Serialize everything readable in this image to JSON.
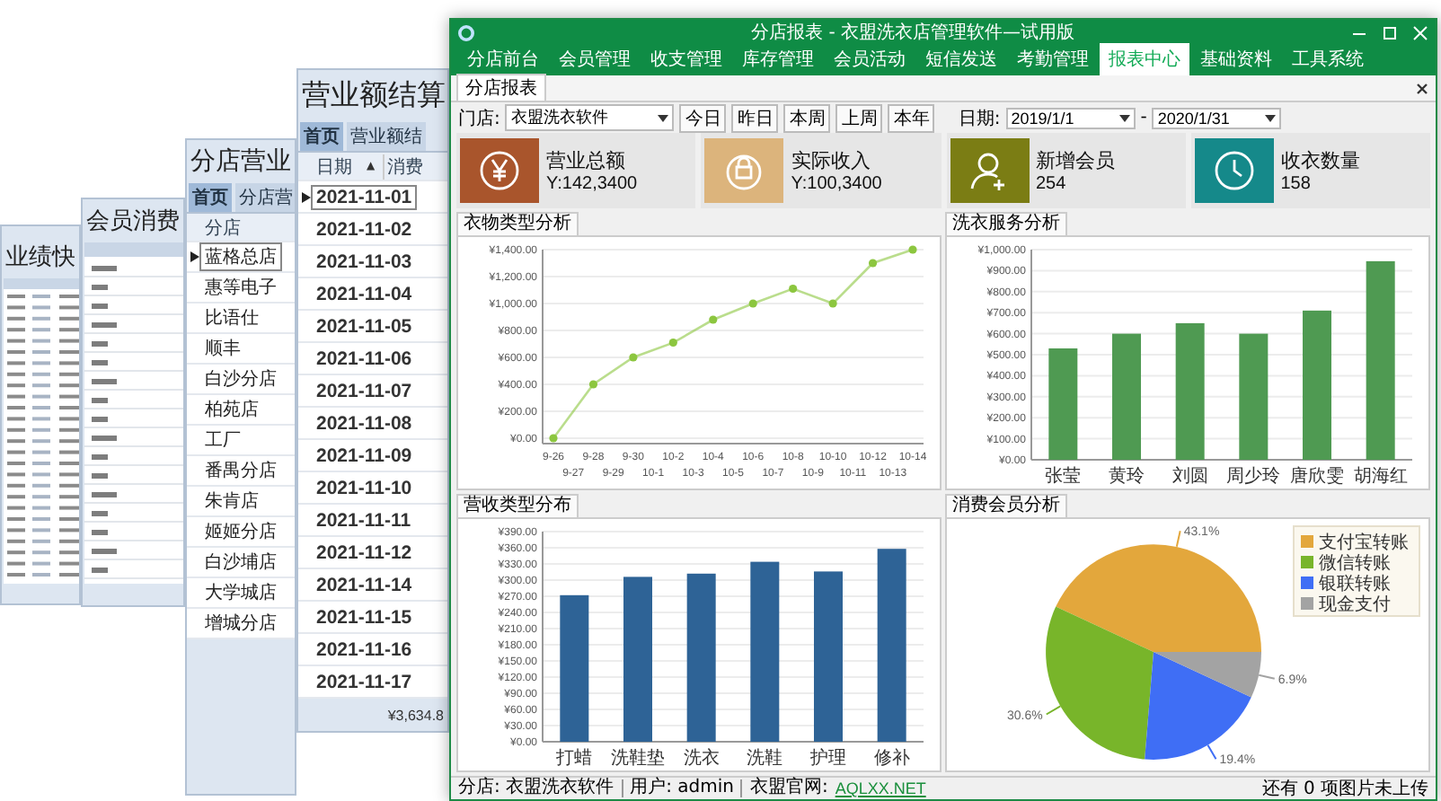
{
  "background_windows": [
    {
      "kind": "mini_table",
      "title": "业绩快"
    },
    {
      "kind": "list",
      "title": "会员消费"
    },
    {
      "kind": "stores",
      "title": "分店营业",
      "tabs": [
        {
          "label": "首页",
          "selected": true
        },
        {
          "label": "分店营",
          "selected": false
        }
      ],
      "column": "分店",
      "rows": [
        {
          "text": "蓝格总店",
          "selected": true
        },
        {
          "text": "惠等电子",
          "selected": false
        },
        {
          "text": "比语仕",
          "selected": false
        },
        {
          "text": "顺丰",
          "selected": false
        },
        {
          "text": "白沙分店",
          "selected": false
        },
        {
          "text": "柏苑店",
          "selected": false
        },
        {
          "text": "工厂",
          "selected": false
        },
        {
          "text": "番禺分店",
          "selected": false
        },
        {
          "text": "朱肯店",
          "selected": false
        },
        {
          "text": "姬姬分店",
          "selected": false
        },
        {
          "text": "白沙埔店",
          "selected": false
        },
        {
          "text": "大学城店",
          "selected": false
        },
        {
          "text": "增城分店",
          "selected": false
        }
      ]
    },
    {
      "kind": "dates",
      "title": "营业额结算",
      "tabs": [
        {
          "label": "首页",
          "selected": true
        },
        {
          "label": "营业额结",
          "selected": false
        }
      ],
      "column": "日期",
      "sort_mark": "▲",
      "column_2": "消费",
      "rows": [
        {
          "text": "2021-11-01",
          "selected": true
        },
        {
          "text": "2021-11-02",
          "selected": false
        },
        {
          "text": "2021-11-03",
          "selected": false
        },
        {
          "text": "2021-11-04",
          "selected": false
        },
        {
          "text": "2021-11-05",
          "selected": false
        },
        {
          "text": "2021-11-06",
          "selected": false
        },
        {
          "text": "2021-11-07",
          "selected": false
        },
        {
          "text": "2021-11-08",
          "selected": false
        },
        {
          "text": "2021-11-09",
          "selected": false
        },
        {
          "text": "2021-11-10",
          "selected": false
        },
        {
          "text": "2021-11-11",
          "selected": false
        },
        {
          "text": "2021-11-12",
          "selected": false
        },
        {
          "text": "2021-11-14",
          "selected": false
        },
        {
          "text": "2021-11-15",
          "selected": false
        },
        {
          "text": "2021-11-16",
          "selected": false
        },
        {
          "text": "2021-11-17",
          "selected": false
        }
      ],
      "total": "¥3,634.8"
    }
  ],
  "main_window": {
    "title": "分店报表 - 衣盟洗衣店管理软件—试用版",
    "menu_tabs": [
      {
        "label": "分店前台",
        "selected": false
      },
      {
        "label": "会员管理",
        "selected": false
      },
      {
        "label": "收支管理",
        "selected": false
      },
      {
        "label": "库存管理",
        "selected": false
      },
      {
        "label": "会员活动",
        "selected": false
      },
      {
        "label": "短信发送",
        "selected": false
      },
      {
        "label": "考勤管理",
        "selected": false
      },
      {
        "label": "报表中心",
        "selected": true
      },
      {
        "label": "基础资料",
        "selected": false
      },
      {
        "label": "工具系统",
        "selected": false
      }
    ],
    "page_tab": "分店报表",
    "filter": {
      "store_label": "门店:",
      "store": "衣盟洗衣软件",
      "quick_buttons": [
        "今日",
        "昨日",
        "本周",
        "上周",
        "本年"
      ],
      "date_label": "日期:",
      "date_from": "2019/1/1",
      "date_sep": "-",
      "date_to": "2020/1/31"
    },
    "cards": [
      {
        "kind": "yen",
        "label": "营业总额",
        "value": "Y:142,3400",
        "color": "#a9552c"
      },
      {
        "kind": "bag",
        "label": "实际收入",
        "value": "Y:100,3400",
        "color": "#dcb47c"
      },
      {
        "kind": "member",
        "label": "新增会员",
        "value": "254",
        "color": "#7b7d14"
      },
      {
        "kind": "clock",
        "label": "收衣数量",
        "value": "158",
        "color": "#15898a"
      }
    ],
    "charts": [
      {
        "tab": "衣物类型分析",
        "chart_data": {
          "type": "line",
          "categories": [
            "9-26",
            "9-27",
            "9-28",
            "9-29",
            "9-30",
            "10-1",
            "10-2",
            "10-3",
            "10-4",
            "10-5",
            "10-6",
            "10-7",
            "10-8",
            "10-9",
            "10-10",
            "10-11",
            "10-12",
            "10-13",
            "10-14"
          ],
          "grid": true,
          "series": [
            {
              "color": "#8cc63f",
              "marker": true,
              "values": [
                0,
                null,
                400,
                null,
                600,
                null,
                710,
                null,
                880,
                null,
                1000,
                null,
                1110,
                null,
                1000,
                null,
                1300,
                null,
                1400
              ]
            }
          ],
          "ylim": [
            0,
            1400
          ],
          "yticks": [
            {
              "value": 0,
              "label": "¥0.00"
            },
            {
              "value": 200,
              "label": "¥200.00"
            },
            {
              "value": 400,
              "label": "¥400.00"
            },
            {
              "value": 600,
              "label": "¥600.00"
            },
            {
              "value": 800,
              "label": "¥800.00"
            },
            {
              "value": 1000,
              "label": "¥1,000.00"
            },
            {
              "value": 1200,
              "label": "¥1,200.00"
            },
            {
              "value": 1400,
              "label": "¥1,400.00"
            }
          ]
        }
      },
      {
        "tab": "洗衣服务分析",
        "chart_data": {
          "type": "bar",
          "categories": [
            "张莹",
            "黄玲",
            "刘圆",
            "周少玲",
            "唐欣雯",
            "胡海红"
          ],
          "grid": true,
          "series": [
            {
              "color": "#4f9a52",
              "values": [
                530,
                600,
                650,
                600,
                710,
                945
              ]
            }
          ],
          "ylim": [
            0,
            1000
          ],
          "yticks": [
            {
              "value": 0,
              "label": "¥0.00"
            },
            {
              "value": 100,
              "label": "¥100.00"
            },
            {
              "value": 200,
              "label": "¥200.00"
            },
            {
              "value": 300,
              "label": "¥300.00"
            },
            {
              "value": 400,
              "label": "¥400.00"
            },
            {
              "value": 500,
              "label": "¥500.00"
            },
            {
              "value": 600,
              "label": "¥600.00"
            },
            {
              "value": 700,
              "label": "¥700.00"
            },
            {
              "value": 800,
              "label": "¥800.00"
            },
            {
              "value": 900,
              "label": "¥900.00"
            },
            {
              "value": 1000,
              "label": "¥1,000.00"
            }
          ]
        }
      },
      {
        "tab": "营收类型分布",
        "chart_data": {
          "type": "bar",
          "categories": [
            "打蜡",
            "洗鞋垫",
            "洗衣",
            "洗鞋",
            "护理",
            "修补"
          ],
          "grid": true,
          "series": [
            {
              "color": "#2e6396",
              "values": [
                272,
                306,
                312,
                334,
                316,
                358
              ]
            }
          ],
          "ylim": [
            0,
            390
          ],
          "yticks": [
            {
              "value": 0,
              "label": "¥0.00"
            },
            {
              "value": 30,
              "label": "¥30.00"
            },
            {
              "value": 60,
              "label": "¥60.00"
            },
            {
              "value": 90,
              "label": "¥90.00"
            },
            {
              "value": 120,
              "label": "¥120.00"
            },
            {
              "value": 150,
              "label": "¥150.00"
            },
            {
              "value": 180,
              "label": "¥180.00"
            },
            {
              "value": 210,
              "label": "¥210.00"
            },
            {
              "value": 240,
              "label": "¥240.00"
            },
            {
              "value": 270,
              "label": "¥270.00"
            },
            {
              "value": 300,
              "label": "¥300.00"
            },
            {
              "value": 330,
              "label": "¥330.00"
            },
            {
              "value": 360,
              "label": "¥360.00"
            },
            {
              "value": 390,
              "label": "¥390.00"
            }
          ]
        }
      },
      {
        "tab": "消费会员分析",
        "chart_data": {
          "type": "pie",
          "legend": "top-right",
          "categories": [
            "支付宝转账",
            "微信转账",
            "银联转账",
            "现金支付"
          ],
          "colors": [
            "#e3a73c",
            "#78b52a",
            "#3f6ef5",
            "#a3a3a3"
          ],
          "values": [
            43.1,
            30.6,
            19.4,
            6.9
          ],
          "value_labels": [
            "43.1%",
            "30.6%",
            "19.4%",
            "6.9%"
          ]
        }
      }
    ],
    "status_bar": {
      "store": "分店: 衣盟洗衣软件",
      "user": "用户: admin",
      "site_label": "衣盟官网:",
      "site_link": "AQLXX.NET",
      "upload": "还有 0 项图片未上传"
    }
  }
}
